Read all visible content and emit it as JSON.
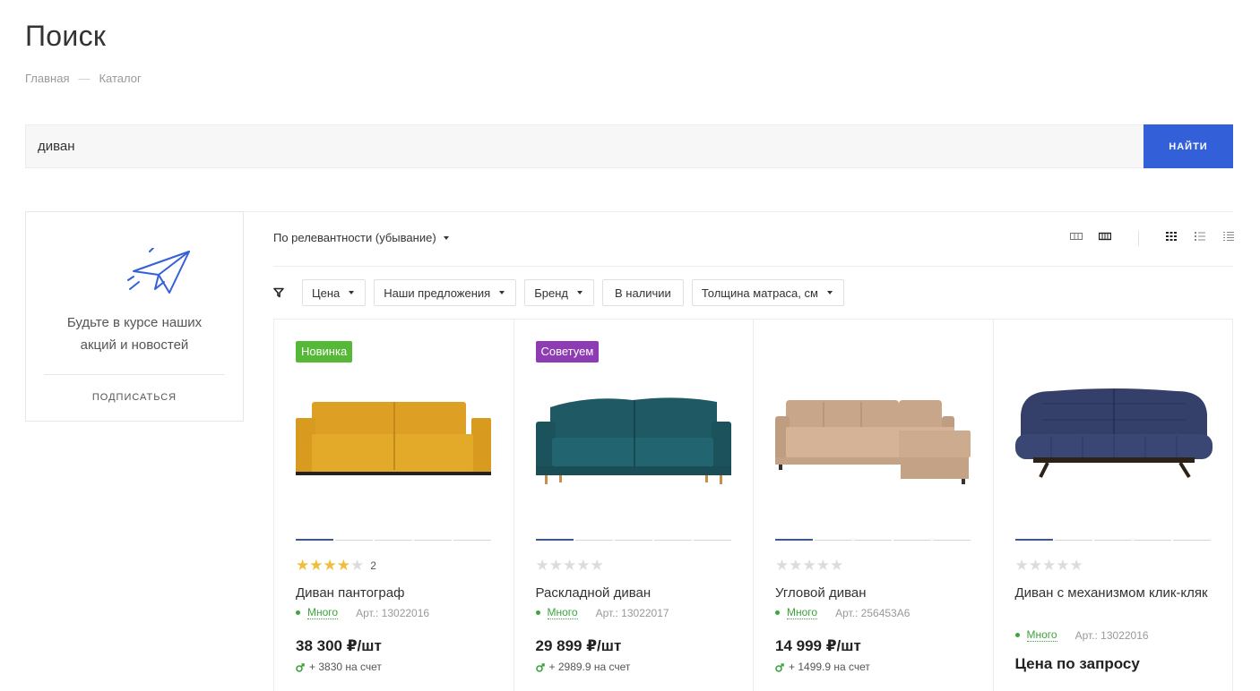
{
  "page": {
    "title": "Поиск"
  },
  "breadcrumb": {
    "home": "Главная",
    "sep": "—",
    "catalog": "Каталог"
  },
  "search": {
    "value": "диван",
    "button": "НАЙТИ"
  },
  "subscribe": {
    "text": "Будьте в курсе наших акций и новостей",
    "link": "ПОДПИСАТЬСЯ",
    "icon": "paper-plane-icon"
  },
  "sort": {
    "label": "По релевантности (убывание)"
  },
  "filters": [
    {
      "label": "Цена",
      "dropdown": true
    },
    {
      "label": "Наши предложения",
      "dropdown": true
    },
    {
      "label": "Бренд",
      "dropdown": true
    },
    {
      "label": "В наличии",
      "dropdown": false
    },
    {
      "label": "Толщина матраса, см",
      "dropdown": true
    }
  ],
  "products": [
    {
      "badge": "Новинка",
      "badge_color": "#55b937",
      "rating": 4,
      "reviews": "2",
      "name": "Диван пантограф",
      "stock": "Много",
      "sku": "Арт.: 13022016",
      "price": "38 300 ₽/шт",
      "bonus": "+ 3830 на счет",
      "sofa_color": "#e0a526"
    },
    {
      "badge": "Советуем",
      "badge_color": "#8e3cb3",
      "rating": 0,
      "reviews": "",
      "name": "Раскладной диван",
      "stock": "Много",
      "sku": "Арт.: 13022017",
      "price": "29 899 ₽/шт",
      "bonus": "+ 2989.9 на счет",
      "sofa_color": "#1f5660"
    },
    {
      "badge": "",
      "badge_color": "",
      "rating": 0,
      "reviews": "",
      "name": "Угловой диван",
      "stock": "Много",
      "sku": "Арт.: 256453А6",
      "price": "14 999 ₽/шт",
      "bonus": "+ 1499.9 на счет",
      "sofa_color": "#c8a68a"
    },
    {
      "badge": "",
      "badge_color": "",
      "rating": 0,
      "reviews": "",
      "name": "Диван с механизмом клик-кляк",
      "stock": "Много",
      "sku": "Арт.: 13022016",
      "price": "Цена по запросу",
      "bonus": "",
      "sofa_color": "#34406a"
    }
  ]
}
